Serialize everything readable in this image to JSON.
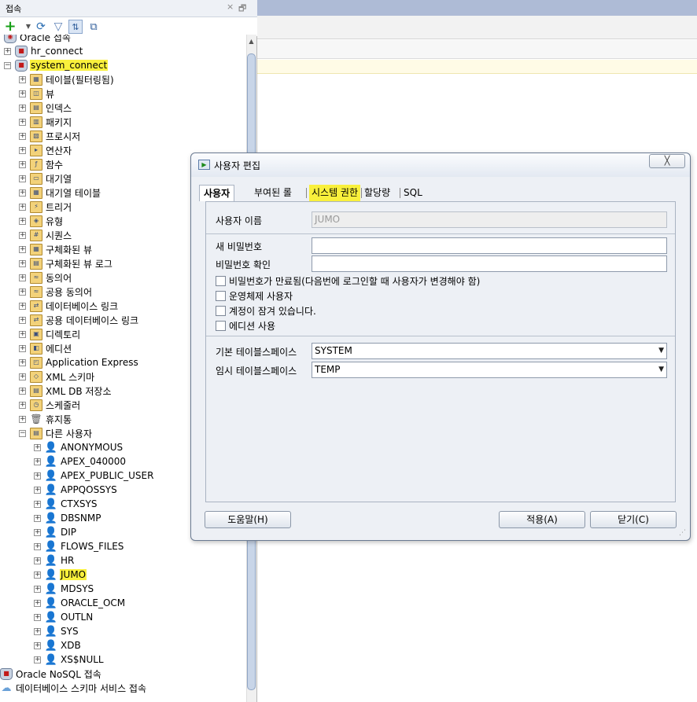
{
  "connections_panel": {
    "title": "접속",
    "close_glyph": "×",
    "restore_glyph": "🗗",
    "toolbar": {
      "add_icon": "plus-icon",
      "refresh_icon": "refresh-icon",
      "filter_icon": "filter-icon",
      "schema_browser_icon": "schema-browser-icon",
      "window_icon": "new-window-icon"
    },
    "tree": {
      "root_label": "Oracle 접속",
      "connections": [
        "hr_connect",
        "system_connect"
      ],
      "categories": [
        "테이블(필터링됨)",
        "뷰",
        "인덱스",
        "패키지",
        "프로시저",
        "연산자",
        "함수",
        "대기열",
        "대기열 테이블",
        "트리거",
        "유형",
        "시퀀스",
        "구체화된 뷰",
        "구체화된 뷰 로그",
        "동의어",
        "공용 동의어",
        "데이터베이스 링크",
        "공용 데이터베이스 링크",
        "디렉토리",
        "에디션",
        "Application Express",
        "XML 스키마",
        "XML DB 저장소",
        "스케줄러",
        "휴지통",
        "다른 사용자"
      ],
      "users": [
        "ANONYMOUS",
        "APEX_040000",
        "APEX_PUBLIC_USER",
        "APPQOSSYS",
        "CTXSYS",
        "DBSNMP",
        "DIP",
        "FLOWS_FILES",
        "HR",
        "JUMO",
        "MDSYS",
        "ORACLE_OCM",
        "OUTLN",
        "SYS",
        "XDB",
        "XS$NULL"
      ],
      "bottom_items": [
        "Oracle NoSQL 접속",
        "데이터베이스 스키마 서비스 접속"
      ]
    }
  },
  "dialog": {
    "title": "사용자 편집",
    "close_label": "╳",
    "tabs": [
      "사용자",
      "부여된 롤",
      "시스템 권한",
      "할당량",
      "SQL"
    ],
    "active_tab": "사용자",
    "form": {
      "username_label": "사용자 이름",
      "username_value": "JUMO",
      "new_password_label": "새 비밀번호",
      "confirm_password_label": "비밀번호 확인",
      "checkboxes": [
        "비밀번호가 만료됨(다음번에 로그인할 때 사용자가 변경해야 함)",
        "운영체제 사용자",
        "계정이 잠겨 있습니다.",
        "에디션 사용"
      ],
      "default_tablespace_label": "기본 테이블스페이스",
      "default_tablespace_value": "SYSTEM",
      "temp_tablespace_label": "임시 테이블스페이스",
      "temp_tablespace_value": "TEMP"
    },
    "buttons": {
      "help": "도움말(H)",
      "apply": "적용(A)",
      "close": "닫기(C)"
    }
  },
  "colors": {
    "highlight": "#f9f03c",
    "dialog_bg": "#edf0f5",
    "titlebar_strip": "#aebbd6"
  }
}
